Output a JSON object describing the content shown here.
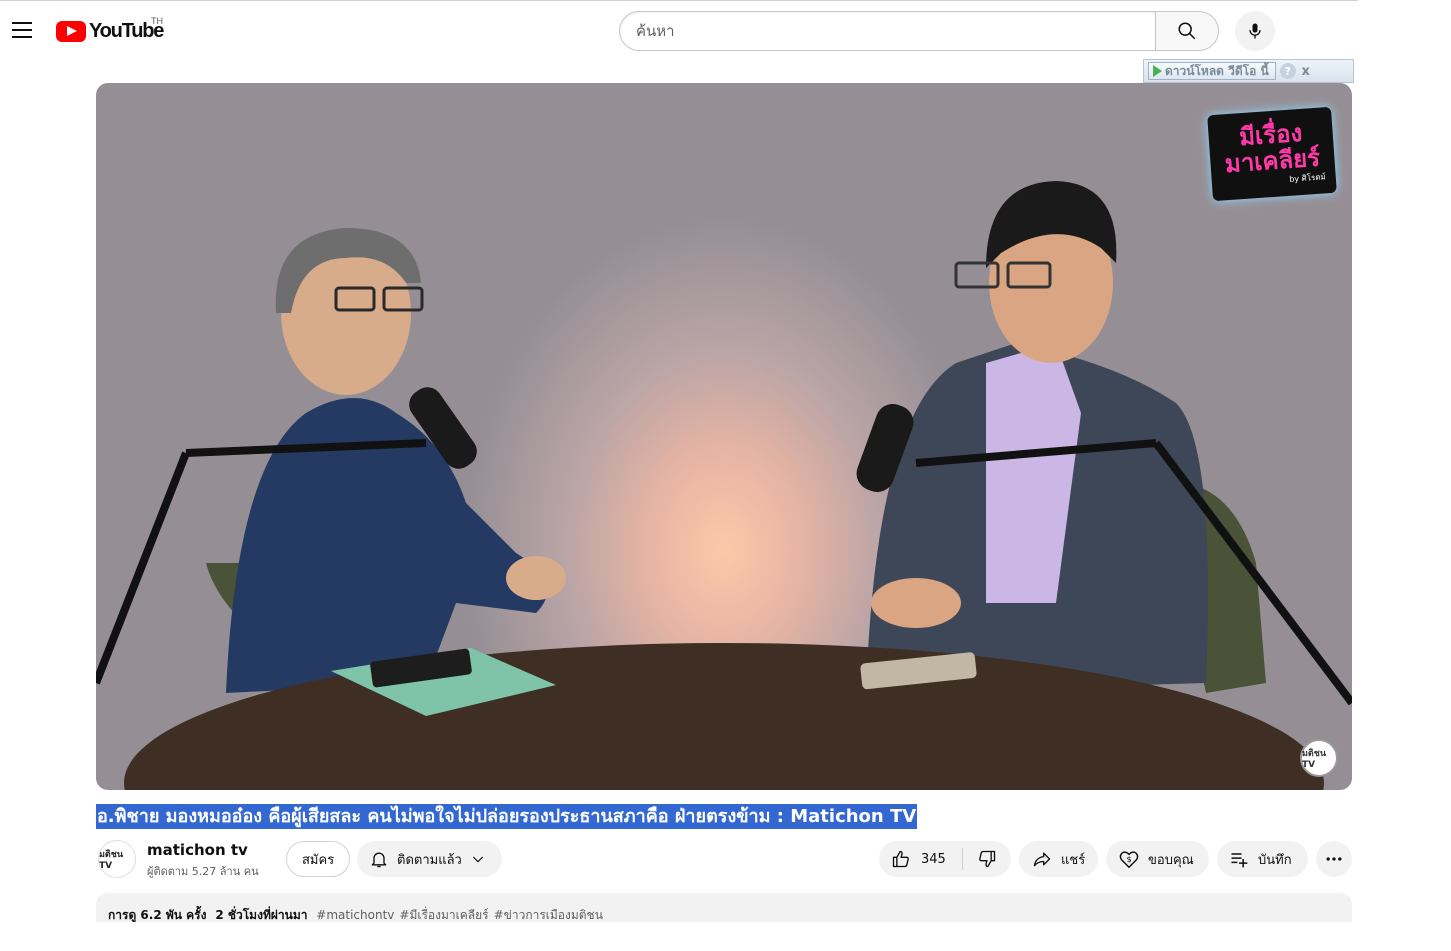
{
  "header": {
    "logo_text": "YouTube",
    "region": "TH",
    "search_placeholder": "ค้นหา"
  },
  "download_bar": {
    "label": "ดาวน์โหลด วีดีโอ นี้",
    "help": "?",
    "close": "x"
  },
  "video": {
    "show_logo_line1": "มีเรื่อง",
    "show_logo_line2": "มาเคลียร์",
    "show_logo_by": "by ศิโรตม์",
    "corner_logo": "มติชน TV",
    "title": "อ.พิชาย มองหมออ๋อง คือผู้เสียสละ คนไม่พอใจไม่ปล่อยรองประธานสภาคือ ฝ่ายตรงข้าม : Matichon TV"
  },
  "owner": {
    "avatar_text": "มติชน TV",
    "channel_name": "matichon tv",
    "subscriber_count": "ผู้ติดตาม 5.27 ล้าน คน",
    "join_label": "สมัคร",
    "subscribed_label": "ติดตามแล้ว"
  },
  "actions": {
    "like_count": "345",
    "share_label": "แชร์",
    "thanks_label": "ขอบคุณ",
    "save_label": "บันทึก"
  },
  "description": {
    "views": "การดู 6.2 พัน ครั้ง",
    "time_ago": "2 ชั่วโมงที่ผ่านมา",
    "hashtags": [
      "#matichontv",
      "#มีเรื่องมาเคลียร์",
      "#ข่าวการเมืองมติชน"
    ]
  }
}
